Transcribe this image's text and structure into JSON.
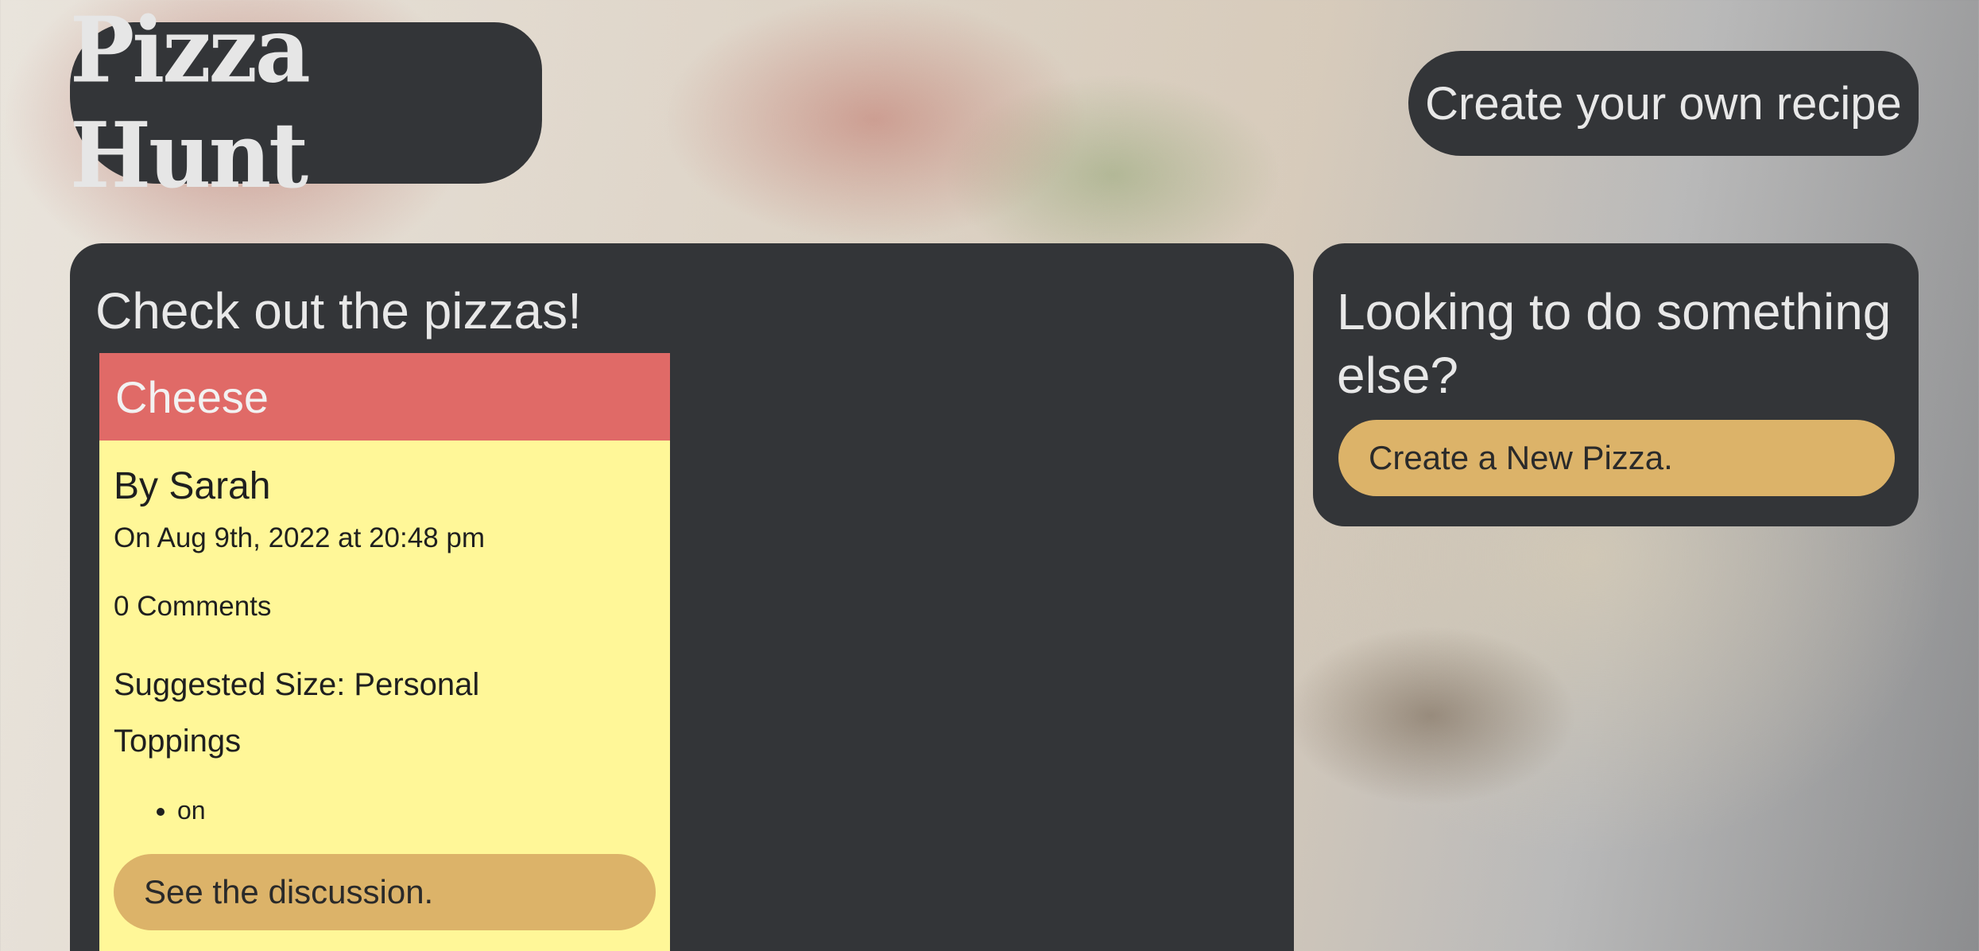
{
  "header": {
    "logo_text": "Pizza Hunt",
    "recipe_button_label": "Create your own recipe"
  },
  "main": {
    "title": "Check out the pizzas!",
    "pizzas": [
      {
        "name": "Cheese",
        "author": "By Sarah",
        "date": "On Aug 9th, 2022 at 20:48 pm",
        "comments": "0 Comments",
        "size": "Suggested Size: Personal",
        "toppings_label": "Toppings",
        "toppings": [
          "on"
        ],
        "discussion_button": "See the discussion."
      }
    ]
  },
  "side": {
    "title": "Looking to do something else?",
    "new_pizza_button": "Create a New Pizza."
  },
  "colors": {
    "panel": "#333538",
    "card_header": "#e06a67",
    "card_body": "#fff798",
    "button": "#dcb369"
  }
}
